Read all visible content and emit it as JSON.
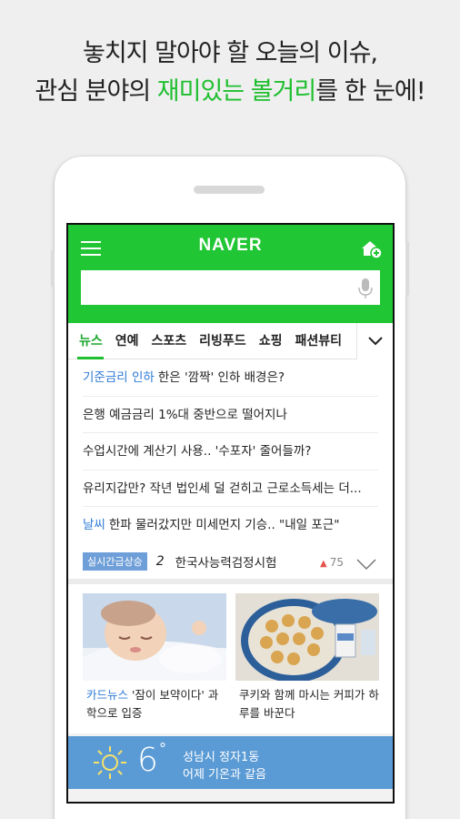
{
  "headline": {
    "line1": "놓치지 말아야 할 오늘의 이슈,",
    "line2_before": "관심 분야의 ",
    "line2_highlight": "재미있는 볼거리",
    "line2_after": "를 한 눈에!"
  },
  "header": {
    "logo": "NAVER",
    "search_value": ""
  },
  "tabs": [
    "뉴스",
    "연예",
    "스포츠",
    "리빙푸드",
    "쇼핑",
    "패션뷰티"
  ],
  "news": [
    {
      "keyword": "기준금리 인하",
      "title": "한은 '깜짝' 인하 배경은?"
    },
    {
      "keyword": "",
      "title": "은행 예금금리 1%대 중반으로 떨어지나"
    },
    {
      "keyword": "",
      "title": "수업시간에 계산기 사용.. '수포자' 줄어들까?"
    },
    {
      "keyword": "",
      "title": "유리지갑만? 작년 법인세 덜 걷히고 근로소득세는 더..."
    },
    {
      "keyword": "날씨",
      "title": "한파 물러갔지만 미세먼지 기승.. \"내일 포근\""
    }
  ],
  "realtime": {
    "badge": "실시간급상승",
    "rank": "2",
    "word": "한국사능력검정시험",
    "change": "75"
  },
  "cards": [
    {
      "keyword": "카드뉴스",
      "text": " '잠이 보약이다' 과학으로 입증"
    },
    {
      "keyword": "",
      "text": "쿠키와 함께 마시는 커피가 하루를 바꾼다"
    }
  ],
  "weather": {
    "temp": "6",
    "deg": "°",
    "location": "성남시 정자1동",
    "compare": "어제 기온과 같음"
  },
  "colors": {
    "naver_green": "#20c633",
    "keyword_blue": "#2f7bd6",
    "weather_bg": "#5b9bd5"
  }
}
